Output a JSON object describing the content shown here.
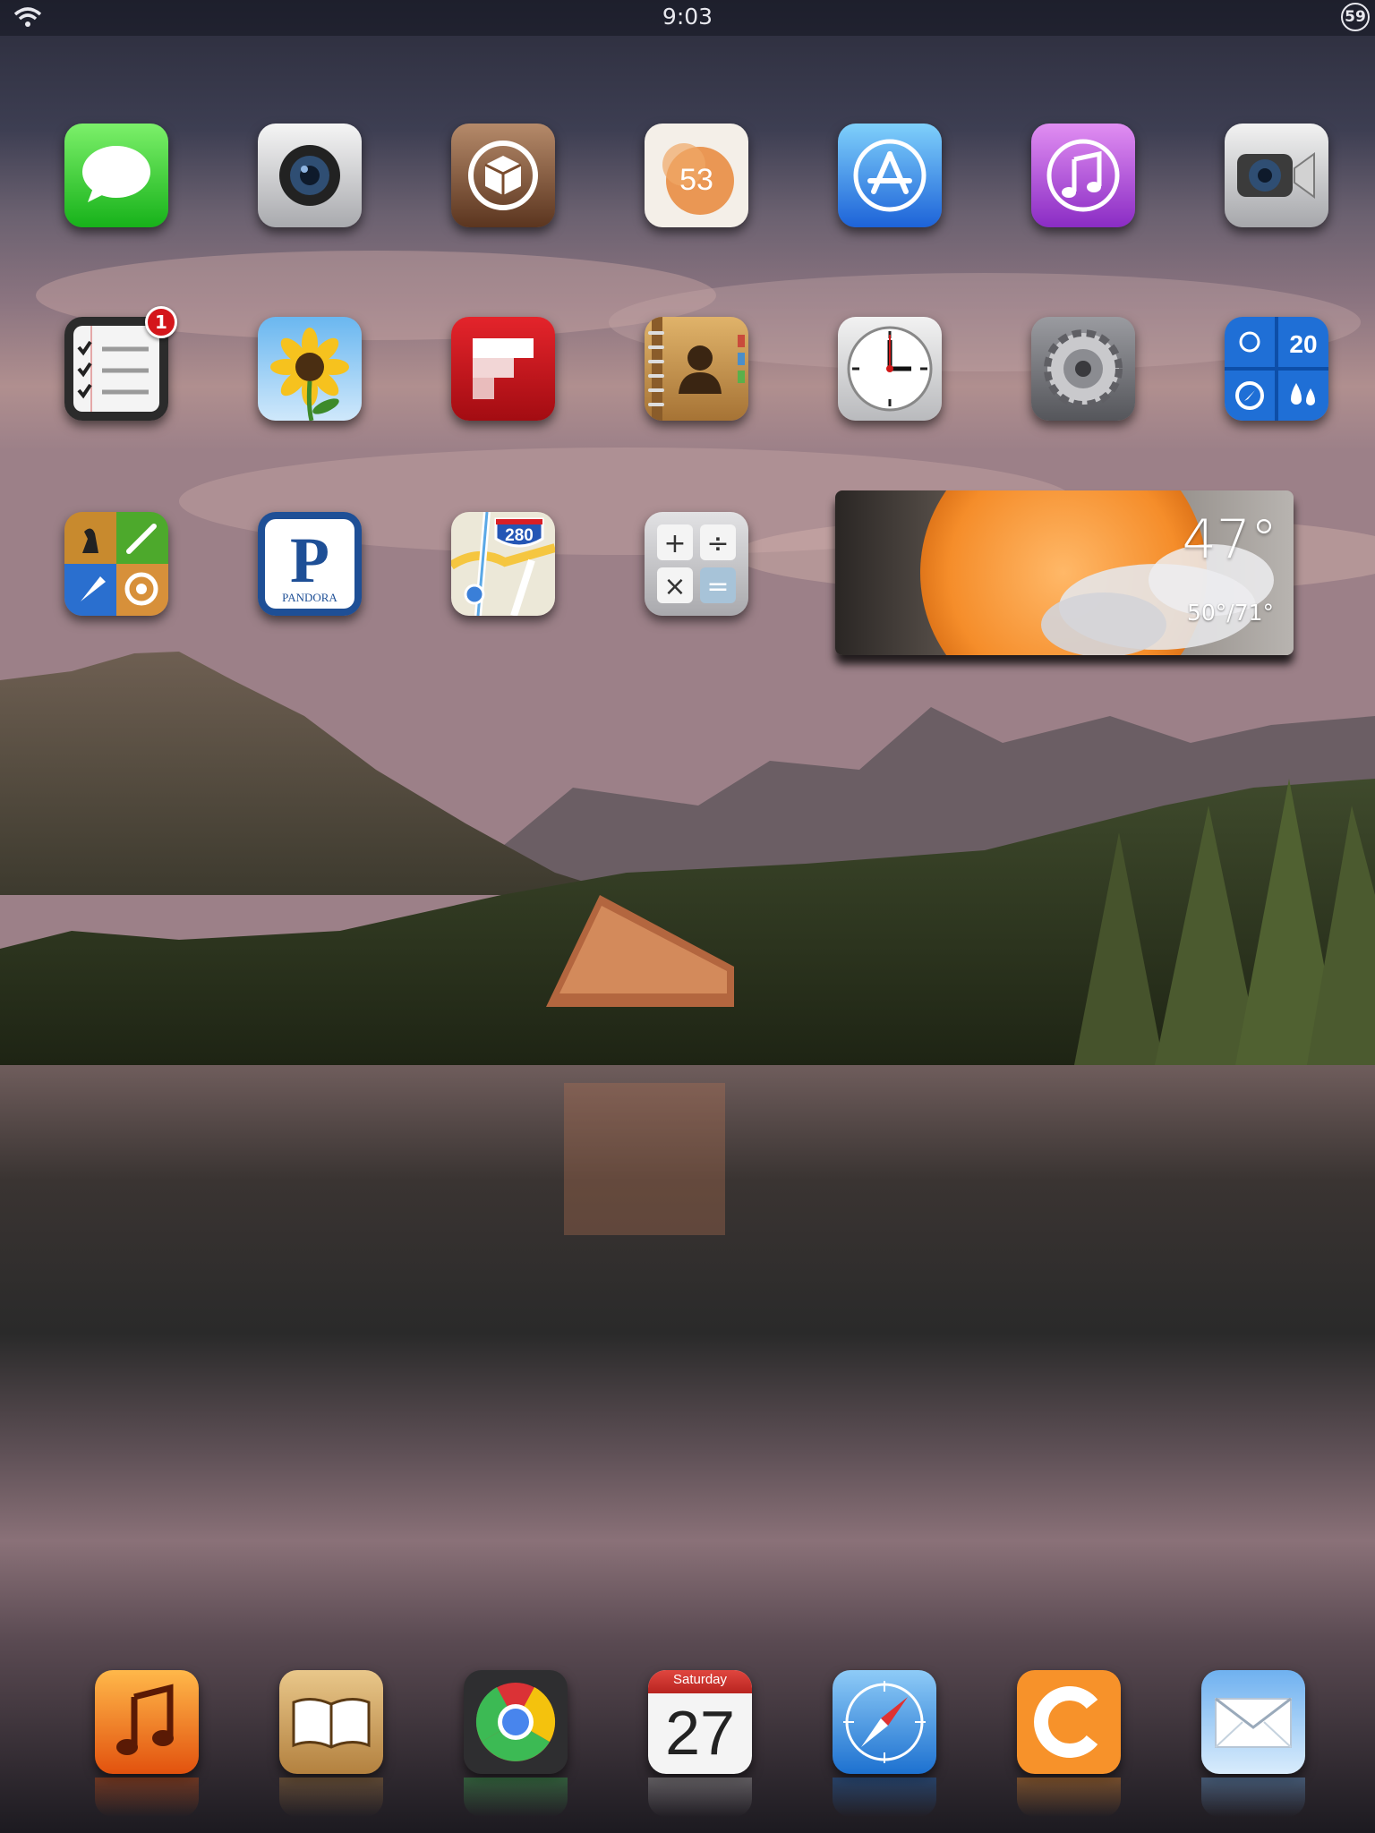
{
  "status_bar": {
    "time": "9:03",
    "battery_level": "59"
  },
  "home_screen": {
    "apps": [
      {
        "name": "Messages",
        "icon": "messages-icon"
      },
      {
        "name": "Camera",
        "icon": "camera-icon"
      },
      {
        "name": "Cydia",
        "icon": "cydia-icon"
      },
      {
        "name": "Paper by FiftyThree",
        "icon": "paper-icon",
        "label": "53"
      },
      {
        "name": "App Store",
        "icon": "app-store-icon"
      },
      {
        "name": "iTunes",
        "icon": "itunes-icon"
      },
      {
        "name": "FaceTime",
        "icon": "facetime-icon"
      },
      {
        "name": "Reminders",
        "icon": "reminders-icon",
        "badge": "1"
      },
      {
        "name": "Photos",
        "icon": "photos-icon"
      },
      {
        "name": "Flipboard",
        "icon": "flipboard-icon"
      },
      {
        "name": "Contacts",
        "icon": "contacts-icon"
      },
      {
        "name": "Clock",
        "icon": "clock-icon"
      },
      {
        "name": "Settings",
        "icon": "settings-icon"
      },
      {
        "name": "Weather app",
        "icon": "weather-app-icon",
        "label": "20"
      },
      {
        "name": "Game Center",
        "icon": "game-center-icon"
      },
      {
        "name": "Pandora",
        "icon": "pandora-icon",
        "label": "PANDORA"
      },
      {
        "name": "Maps",
        "icon": "maps-icon",
        "label": "280"
      },
      {
        "name": "Calculator",
        "icon": "calculator-icon"
      }
    ],
    "weather_widget": {
      "temperature": "47°",
      "range": "50°/71°",
      "icon": "sun-cloud-icon"
    }
  },
  "dock": {
    "apps": [
      {
        "name": "Music",
        "icon": "music-icon"
      },
      {
        "name": "iBooks",
        "icon": "ibooks-icon"
      },
      {
        "name": "Chrome",
        "icon": "chrome-icon"
      },
      {
        "name": "Calendar",
        "icon": "calendar-icon",
        "weekday": "Saturday",
        "day": "27"
      },
      {
        "name": "Safari",
        "icon": "safari-icon"
      },
      {
        "name": "Cloud app",
        "icon": "cloud-app-icon"
      },
      {
        "name": "Mail",
        "icon": "mail-icon"
      }
    ]
  },
  "colors": {
    "status_text": "#e8e8ee",
    "badge_red": "#d4161b"
  }
}
